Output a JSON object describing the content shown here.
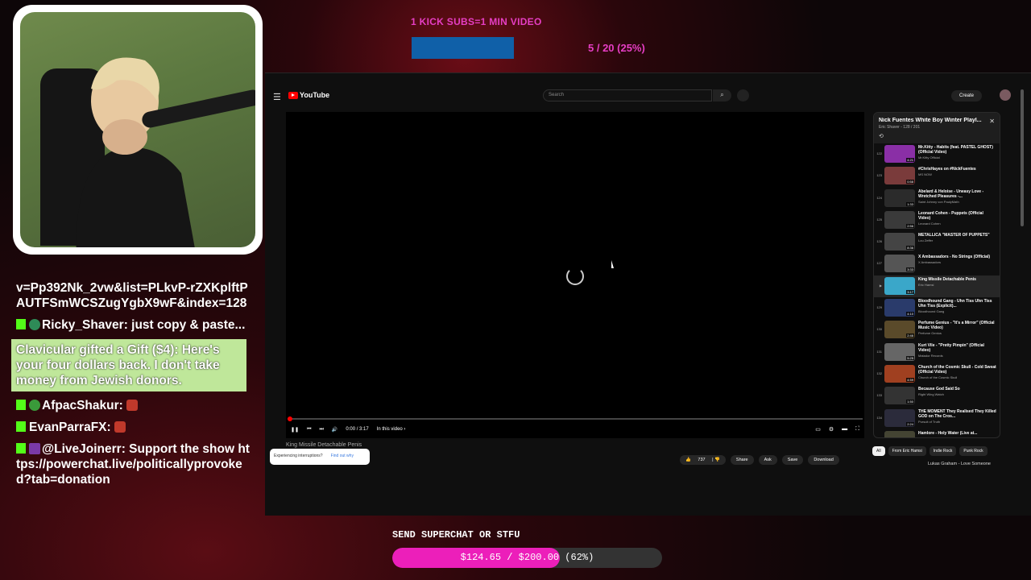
{
  "top_goal": {
    "title": "1 KICK SUBS=1 MIN VIDEO",
    "count_text": "5 / 20 (25%)",
    "progress_fraction": 0.25,
    "fill_color": "#1060a8"
  },
  "chat": {
    "link_fragment": "v=Pp392Nk_2vw&list=PLkvP-rZXKplftPAUTFSmWCSZugYgbX9wF&index=128",
    "messages": [
      {
        "user": "Ricky_Shaver",
        "text": "just copy & paste..."
      },
      {
        "user": "AfpacShakur",
        "text": ""
      },
      {
        "user": "EvanParraFX",
        "text": ""
      },
      {
        "user": "@LiveJoinerr",
        "text": "Support the show https://powerchat.live/politicallyprovoked?tab=donation"
      }
    ],
    "gift": "Clavicular gifted a Gift ($4): Here's your four dollars back. I don't take money from Jewish donors."
  },
  "youtube": {
    "logo": "YouTube",
    "search_placeholder": "Search",
    "create_label": "Create",
    "time": "0:00 / 3:17",
    "in_this_video": "In this video",
    "video_title": "King Missile Detachable Penis",
    "interruption_text": "Experiencing interruptions?",
    "find_out_why": "Find out why",
    "actions": {
      "likes": "737",
      "share": "Share",
      "ask": "Ask",
      "save": "Save",
      "download": "Download"
    },
    "playlist": {
      "title": "Nick Fuentes White Boy Winter Playl...",
      "subtitle": "Eric Shaver - 128 / 201",
      "items": [
        {
          "idx": "122",
          "title": "Mr.Kitty - Habits (feat. PASTEL GHOST) (Official Video)",
          "channel": "Mr.Kitty Official",
          "dur": "4:21",
          "color": "#8a2fa6"
        },
        {
          "idx": "123",
          "title": "#ChrisHayes on #NickFuentes",
          "channel": "MS NOW",
          "dur": "0:58",
          "color": "#7a3b3b"
        },
        {
          "idx": "124",
          "title": "Abelard & Heloise - Uneasy Love - Wretched Pleasures -...",
          "channel": "Saint Johnny von PaulyMath",
          "dur": "1:33",
          "color": "#2b2b2b"
        },
        {
          "idx": "125",
          "title": "Leonard Cohen - Puppets (Official Video)",
          "channel": "Leonard Cohen",
          "dur": "2:56",
          "color": "#3a3a3a"
        },
        {
          "idx": "126",
          "title": "METALLICA \"MASTER OF PUPPETS\"",
          "channel": "Lou Zeffer",
          "dur": "8:36",
          "color": "#444"
        },
        {
          "idx": "127",
          "title": "X Ambassadors - No Strings (Official)",
          "channel": "X Ambassadors",
          "dur": "3:33",
          "color": "#555"
        },
        {
          "idx": "▶",
          "title": "King Missile Detachable Penis",
          "channel": "Eric Hamsi",
          "dur": "3:17",
          "color": "#3aa7c9"
        },
        {
          "idx": "129",
          "title": "Bloodhound Gang - Uhn Tiss Uhn Tiss Uhn Tiss (Explicit)...",
          "channel": "Bloodhound Gang",
          "dur": "4:10",
          "color": "#2a3b6b"
        },
        {
          "idx": "130",
          "title": "Perfume Genius - \"It's a Mirror\" (Official Music Video)",
          "channel": "Perfume Genius",
          "dur": "2:46",
          "color": "#5a4a2a"
        },
        {
          "idx": "131",
          "title": "Kurt Vile - \"Pretty Pimpin\" (Official Video)",
          "channel": "Matador Records",
          "dur": "5:25",
          "color": "#666"
        },
        {
          "idx": "132",
          "title": "Church of the Cosmic Skull - Cold Sweat (Official Video)",
          "channel": "Church of the Cosmic Skull",
          "dur": "4:59",
          "color": "#a04020"
        },
        {
          "idx": "133",
          "title": "Because God Said So",
          "channel": "Right Wing Watch",
          "dur": "1:50",
          "color": "#333"
        },
        {
          "idx": "134",
          "title": "THE MOMENT They Realised They Killed GOD on The Cros...",
          "channel": "Pursuit of Truth",
          "dur": "2:24",
          "color": "#2b2b3b"
        },
        {
          "idx": "135",
          "title": "Hamlore - Holy Water (Live at...",
          "channel": "",
          "dur": "",
          "color": "#443"
        }
      ]
    },
    "chips": [
      "All",
      "From Eric Hamsi",
      "Indie Rock",
      "Punk Rock"
    ],
    "next_item": "Lukas Graham - Love Someone"
  },
  "superchat": {
    "label": "SEND SUPERCHAT OR STFU",
    "amount_text": "$124.65 / $200.00 (62%)",
    "progress_fraction": 0.62,
    "fill_color": "#ec1fba"
  }
}
